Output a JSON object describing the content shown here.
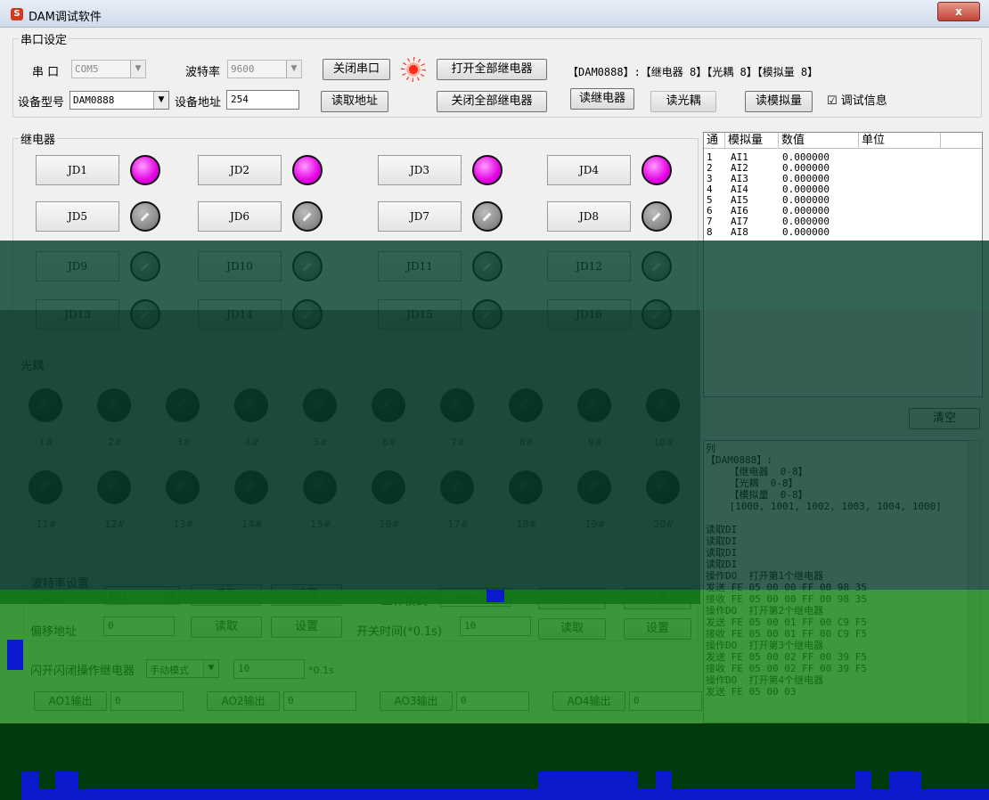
{
  "window": {
    "title": "DAM调试软件",
    "close": "x"
  },
  "serial": {
    "legend": "串口设定",
    "port_label": "串  口",
    "port_value": "COM5",
    "baud_label": "波特率",
    "baud_value": "9600",
    "close_port": "关闭串口",
    "open_all": "打开全部继电器",
    "close_all": "关闭全部继电器",
    "info": "【DAM0888】:【继电器 8】【光耦 8】【模拟量 8】",
    "model_label": "设备型号",
    "model_value": "DAM0888",
    "addr_label": "设备地址",
    "addr_value": "254",
    "read_addr": "读取地址",
    "read_relay": "读继电器",
    "read_opto": "读光耦",
    "read_analog": "读模拟量",
    "debug_label": "调试信息",
    "debug_checked": "☑"
  },
  "relay": {
    "legend": "继电器",
    "buttons": [
      "JD1",
      "JD2",
      "JD3",
      "JD4",
      "JD5",
      "JD6",
      "JD7",
      "JD8",
      "JD9",
      "JD10",
      "JD11",
      "JD12",
      "JD13",
      "JD14",
      "JD15",
      "JD16"
    ],
    "states": [
      "on",
      "on",
      "on",
      "on",
      "off",
      "off",
      "off",
      "off",
      "off",
      "off",
      "off",
      "off",
      "off",
      "off",
      "off",
      "off"
    ]
  },
  "analog_table": {
    "headers": [
      "通",
      "模拟量",
      "数值",
      "单位"
    ],
    "rows": [
      {
        "ch": "1",
        "name": "AI1",
        "value": "0.000000"
      },
      {
        "ch": "2",
        "name": "AI2",
        "value": "0.000000"
      },
      {
        "ch": "3",
        "name": "AI3",
        "value": "0.000000"
      },
      {
        "ch": "4",
        "name": "AI4",
        "value": "0.000000"
      },
      {
        "ch": "5",
        "name": "AI5",
        "value": "0.000000"
      },
      {
        "ch": "6",
        "name": "AI6",
        "value": "0.000000"
      },
      {
        "ch": "7",
        "name": "AI7",
        "value": "0.000000"
      },
      {
        "ch": "8",
        "name": "AI8",
        "value": "0.000000"
      }
    ]
  },
  "clear_button": "清空",
  "opto": {
    "legend": "光耦",
    "labels": [
      "1#",
      "2#",
      "3#",
      "4#",
      "5#",
      "6#",
      "7#",
      "8#",
      "9#",
      "10#",
      "11#",
      "12#",
      "13#",
      "14#",
      "15#",
      "16#",
      "17#",
      "18#",
      "19#",
      "20#"
    ]
  },
  "baud_settings": {
    "legend": "波特率设置",
    "baud_label": "波特率",
    "baud_value": "默认",
    "read": "读取",
    "set": "设置",
    "work_mode_label": "工作模式",
    "work_mode_value": "正常模式",
    "offset_label": "偏移地址",
    "offset_value": "0",
    "switch_time_label": "开关时间(*0.1s)",
    "switch_time_value": "10",
    "flash_label": "闪开闪闭操作继电器",
    "flash_mode": "手动模式",
    "flash_value": "10",
    "flash_unit": "*0.1s",
    "ao": [
      {
        "label": "AO1输出",
        "value": "0"
      },
      {
        "label": "AO2输出",
        "value": "0"
      },
      {
        "label": "AO3输出",
        "value": "0"
      },
      {
        "label": "AO4输出",
        "value": "0"
      }
    ]
  },
  "log": {
    "lines": [
      "列",
      "【DAM0888】:",
      "    【继电器  0-8】",
      "    【光耦  0-8】",
      "    【模拟量  0-8】",
      "    [1000, 1001, 1002, 1003, 1004, 1000]",
      "",
      "读取DI",
      "读取DI",
      "读取DI",
      "读取DI",
      "操作DO  打开第1个继电器",
      "发送 FE 05 00 00 FF 00 98 35",
      "接收 FE 05 00 00 FF 00 98 35",
      "操作DO  打开第2个继电器",
      "发送 FE 05 00 01 FF 00 C9 F5",
      "接收 FE 05 00 01 FF 00 C9 F5",
      "操作DO  打开第3个继电器",
      "发送 FE 05 00 02 FF 00 39 F5",
      "接收 FE 05 00 02 FF 00 39 F5",
      "操作DO  打开第4个继电器",
      "发送 FE 05 00 03"
    ]
  }
}
